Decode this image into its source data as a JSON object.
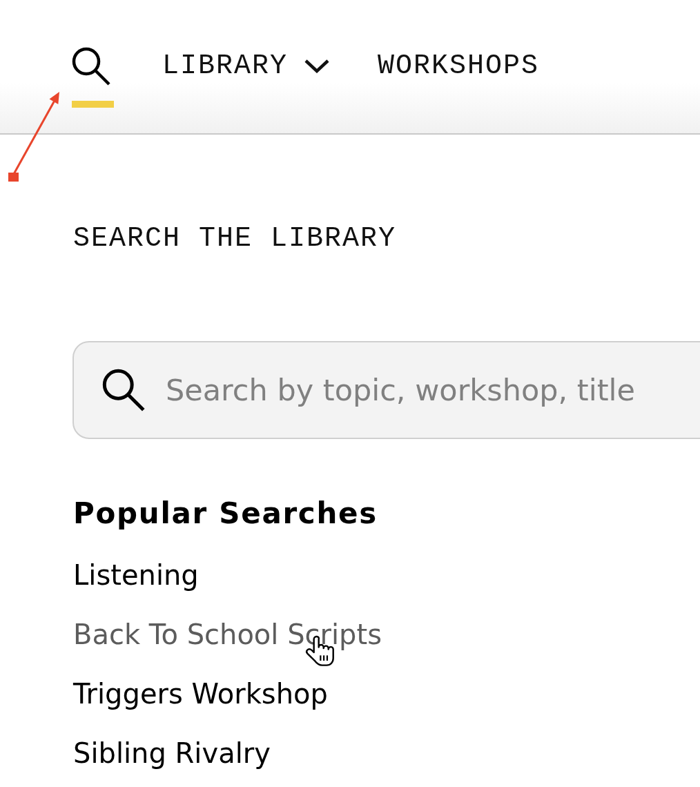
{
  "nav": [
    {
      "kind": "search",
      "selected": true
    },
    {
      "kind": "dropdown",
      "label": "LIBRARY",
      "selected": false
    },
    {
      "kind": "link",
      "label": "WORKSHOPS",
      "selected": false
    }
  ],
  "heading": "SEARCH THE LIBRARY",
  "search": {
    "placeholder": "Search by topic, workshop, title"
  },
  "popular": {
    "title": "Popular Searches",
    "items": [
      {
        "label": "Listening",
        "hovered": false
      },
      {
        "label": "Back To School Scripts",
        "hovered": true
      },
      {
        "label": "Triggers Workshop",
        "hovered": false
      },
      {
        "label": "Sibling Rivalry",
        "hovered": false
      }
    ]
  }
}
